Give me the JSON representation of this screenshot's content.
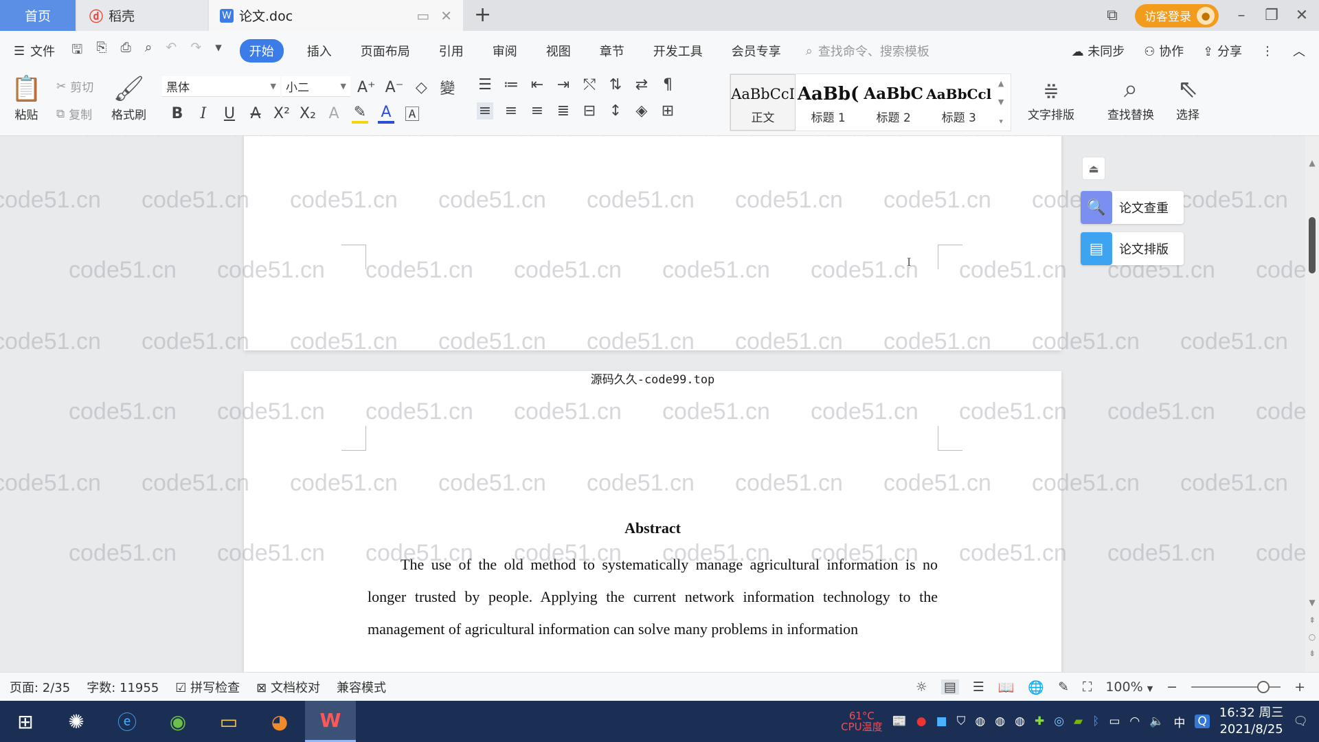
{
  "tabs": {
    "home": "首页",
    "docer": "稻壳",
    "file": "论文.doc",
    "new_tab": "+"
  },
  "account": {
    "visitor_login": "访客登录"
  },
  "menu": {
    "file": "文件",
    "items": [
      "开始",
      "插入",
      "页面布局",
      "引用",
      "审阅",
      "视图",
      "章节",
      "开发工具",
      "会员专享"
    ],
    "search_placeholder": "查找命令、搜索模板",
    "sync": "未同步",
    "collab": "协作",
    "share": "分享"
  },
  "toolbar": {
    "paste": "粘贴",
    "cut": "剪切",
    "copy": "复制",
    "format_painter": "格式刷",
    "font_name": "黑体",
    "font_size": "小二",
    "styles": [
      {
        "preview": "AaBbCcI",
        "name": "正文"
      },
      {
        "preview": "AaBb(",
        "name": "标题 1"
      },
      {
        "preview": "AaBbC",
        "name": "标题 2"
      },
      {
        "preview": "AaBbCcl",
        "name": "标题 3"
      }
    ],
    "text_layout": "文字排版",
    "find_replace": "查找替换",
    "select": "选择"
  },
  "side_panel": {
    "paper_check": "论文查重",
    "paper_format": "论文排版"
  },
  "document": {
    "page_header": "源码久久-code99.top",
    "abstract_title": "Abstract",
    "abstract_text": "The use of the old method to systematically manage agricultural information is no longer trusted by people. Applying the current network information technology to the management of agricultural information can solve many problems in information",
    "cursor": "I"
  },
  "watermark": "code51.cn",
  "status": {
    "page": "页面: 2/35",
    "words": "字数: 11955",
    "spell_check": "拼写检查",
    "doc_proof": "文档校对",
    "compat_mode": "兼容模式",
    "zoom": "100%"
  },
  "taskbar": {
    "cpu_temp": "61°C",
    "cpu_label": "CPU温度",
    "ime": "中",
    "time": "16:32 周三",
    "date": "2021/8/25"
  },
  "colors": {
    "accent": "#3b7ce8",
    "home_tab": "#5b8fe6",
    "visitor": "#f29b1d",
    "taskbar": "#1b2f54",
    "paper_check_icon": "#7b8ff0",
    "paper_format_icon": "#3ea3f0"
  }
}
